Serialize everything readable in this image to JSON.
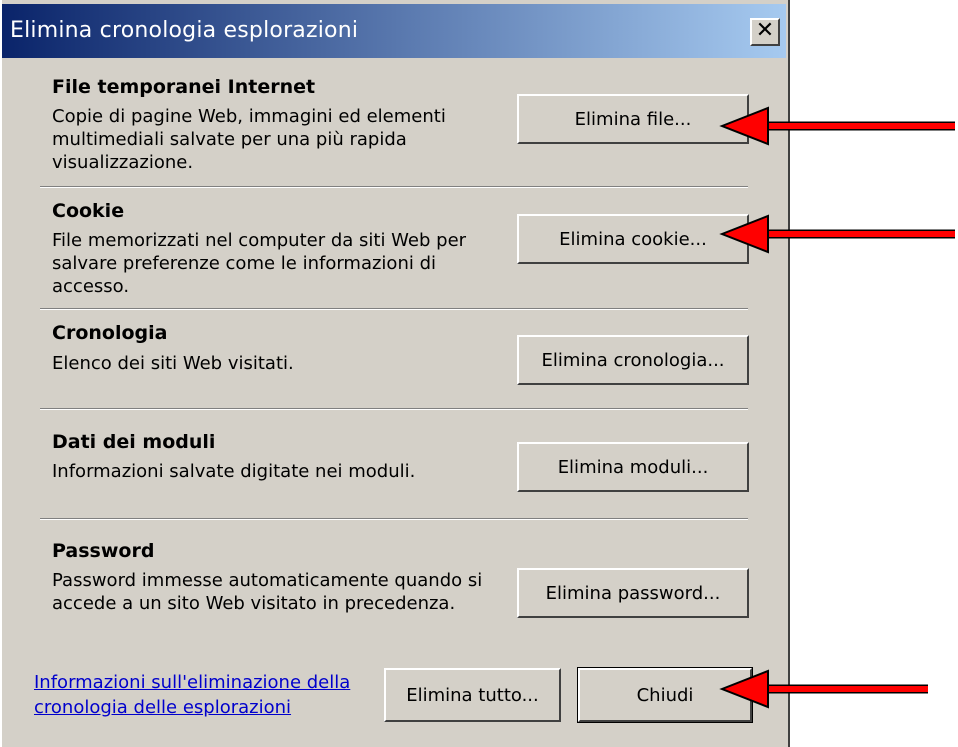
{
  "window": {
    "title": "Elimina cronologia esplorazioni",
    "close_glyph": "✕"
  },
  "sections": [
    {
      "title": "File temporanei Internet",
      "description": "Copie di pagine Web, immagini ed elementi multimediali salvate per una più rapida visualizzazione.",
      "button": "Elimina file..."
    },
    {
      "title": "Cookie",
      "description": "File memorizzati nel computer da siti Web per salvare preferenze come le informazioni di accesso.",
      "button": "Elimina cookie..."
    },
    {
      "title": "Cronologia",
      "description": "Elenco dei siti Web visitati.",
      "button": "Elimina cronologia..."
    },
    {
      "title": "Dati dei moduli",
      "description": "Informazioni salvate digitate nei moduli.",
      "button": "Elimina moduli..."
    },
    {
      "title": "Password",
      "description": "Password immesse automaticamente quando si accede a un sito Web visitato in precedenza.",
      "button": "Elimina password..."
    }
  ],
  "footer": {
    "link": "Informazioni sull'eliminazione della cronologia delle esplorazioni",
    "delete_all_button": "Elimina tutto...",
    "close_button": "Chiudi"
  },
  "colors": {
    "titlebar_start": "#0a246a",
    "titlebar_end": "#a6caf0",
    "dialog_bg": "#d4d0c8",
    "arrow": "#ff0000"
  }
}
